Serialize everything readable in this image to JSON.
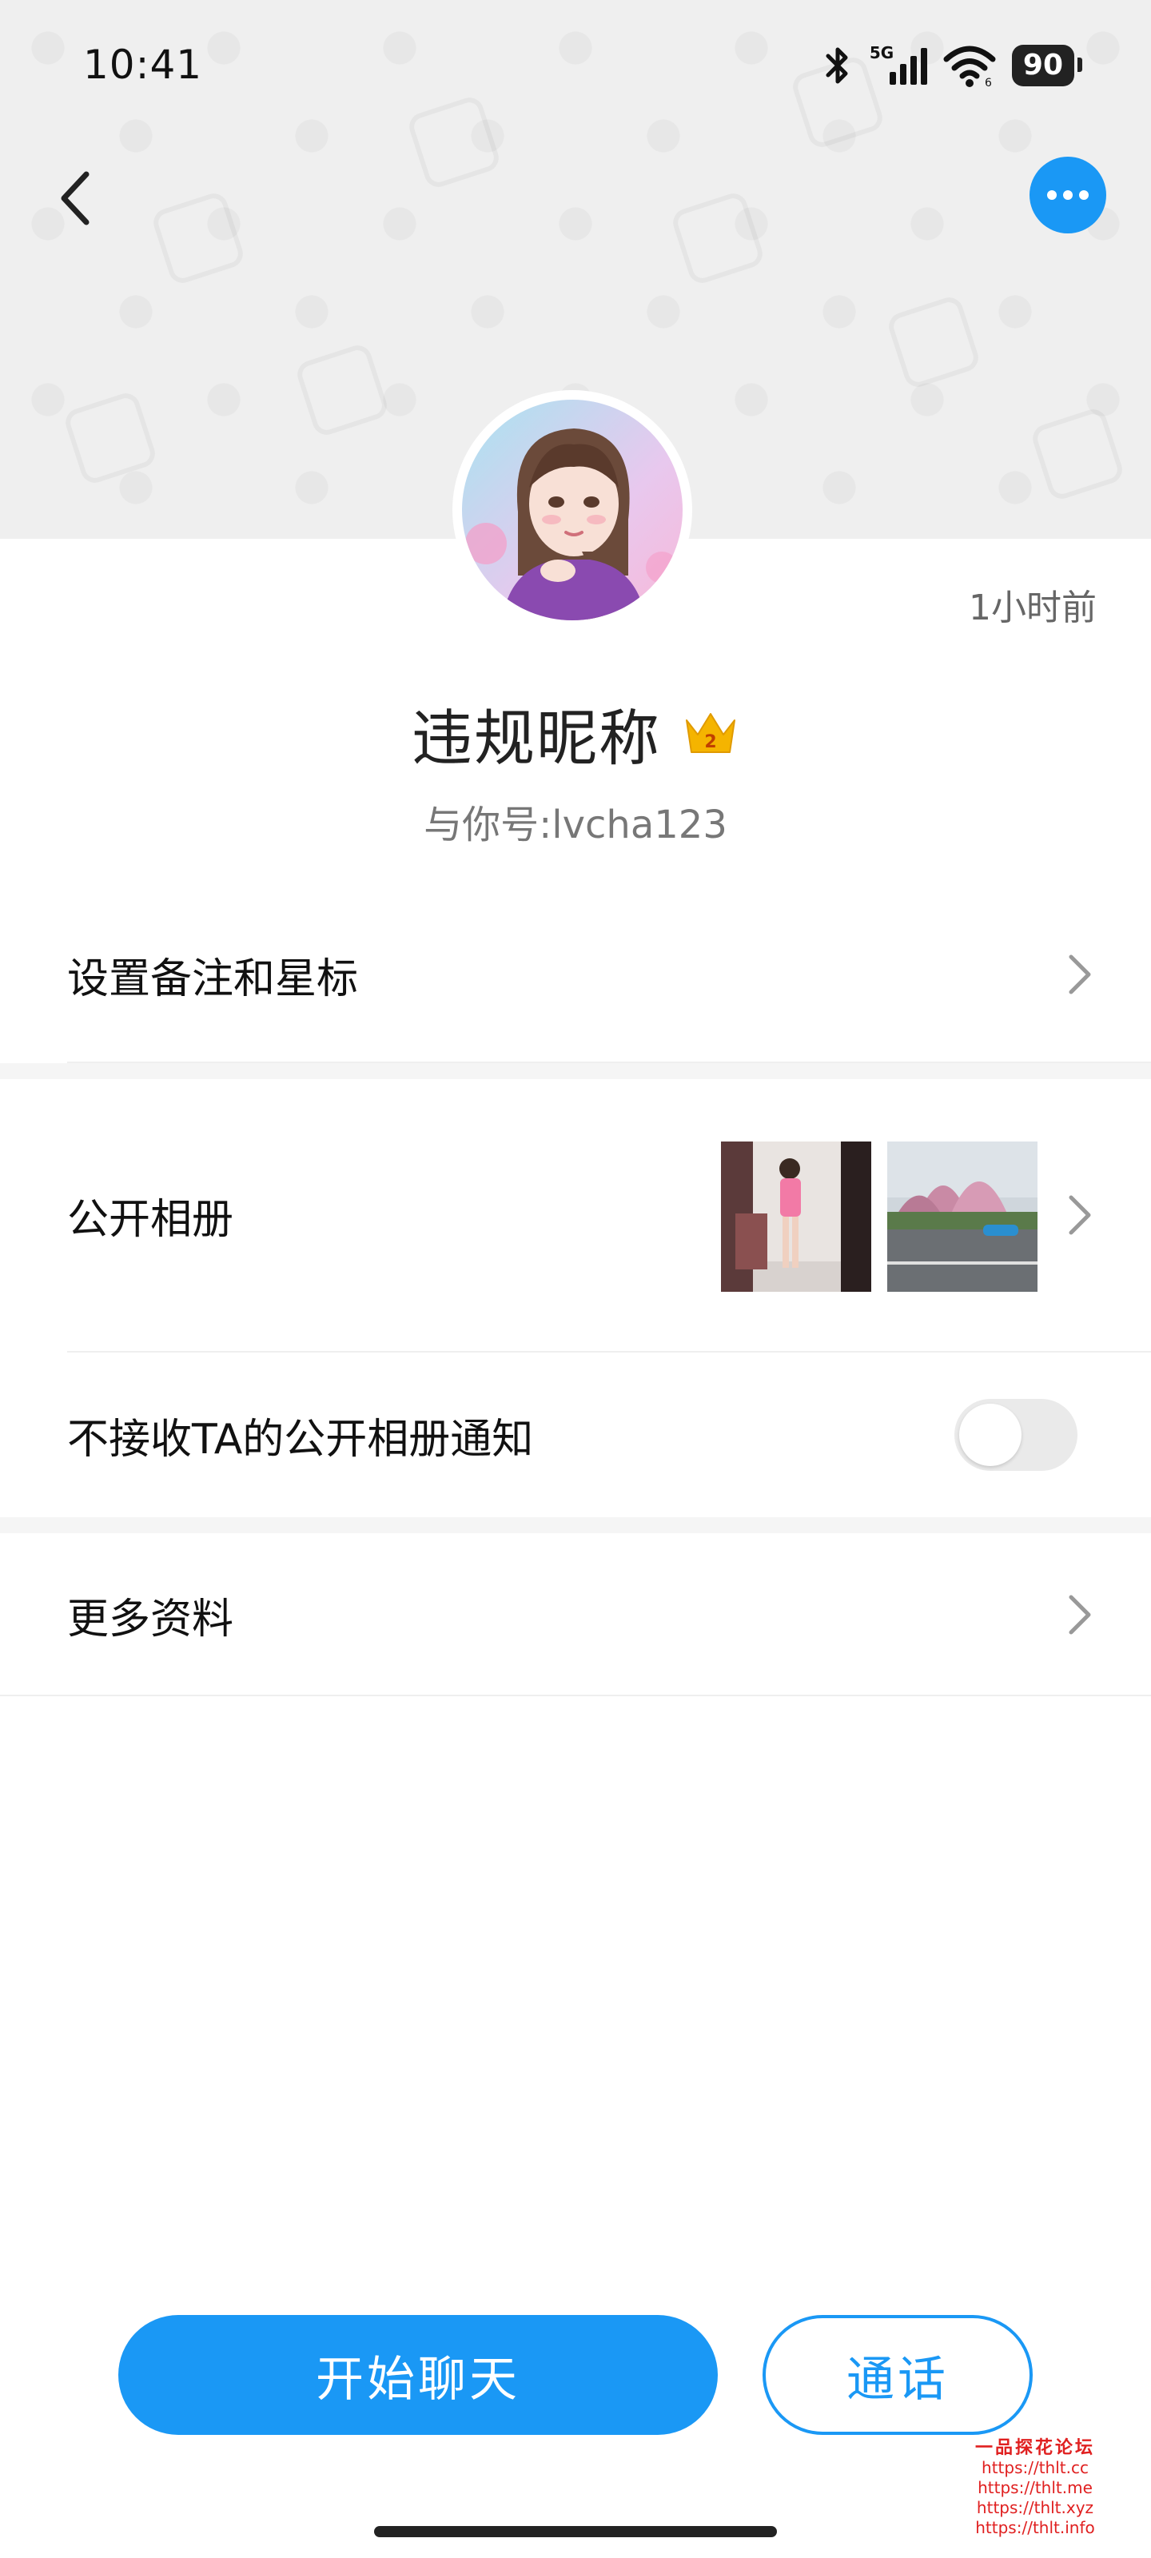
{
  "status_bar": {
    "time": "10:41",
    "network": "5G",
    "wifi_band": "6",
    "battery": "90",
    "icons": [
      "bluetooth-icon",
      "signal-icon",
      "wifi-icon",
      "battery-icon"
    ]
  },
  "header": {
    "back_icon": "chevron-left-icon",
    "more_icon": "more-dots-icon"
  },
  "profile": {
    "last_seen": "1小时前",
    "nickname": "违规昵称",
    "badge_level": "2",
    "account_line": "与你号:lvcha123"
  },
  "rows": {
    "remark_label": "设置备注和星标",
    "album_label": "公开相册",
    "album_notify_label": "不接收TA的公开相册通知",
    "album_notify_on": false,
    "more_info_label": "更多资料"
  },
  "actions": {
    "start_chat": "开始聊天",
    "call": "通话"
  },
  "watermark": {
    "title": "一品探花论坛",
    "lines": [
      "https://thlt.cc",
      "https://thlt.me",
      "https://thlt.xyz",
      "https://thlt.info"
    ]
  },
  "colors": {
    "accent": "#1a98f5",
    "header_bg": "#efefef",
    "divider": "#f5f5f5"
  }
}
